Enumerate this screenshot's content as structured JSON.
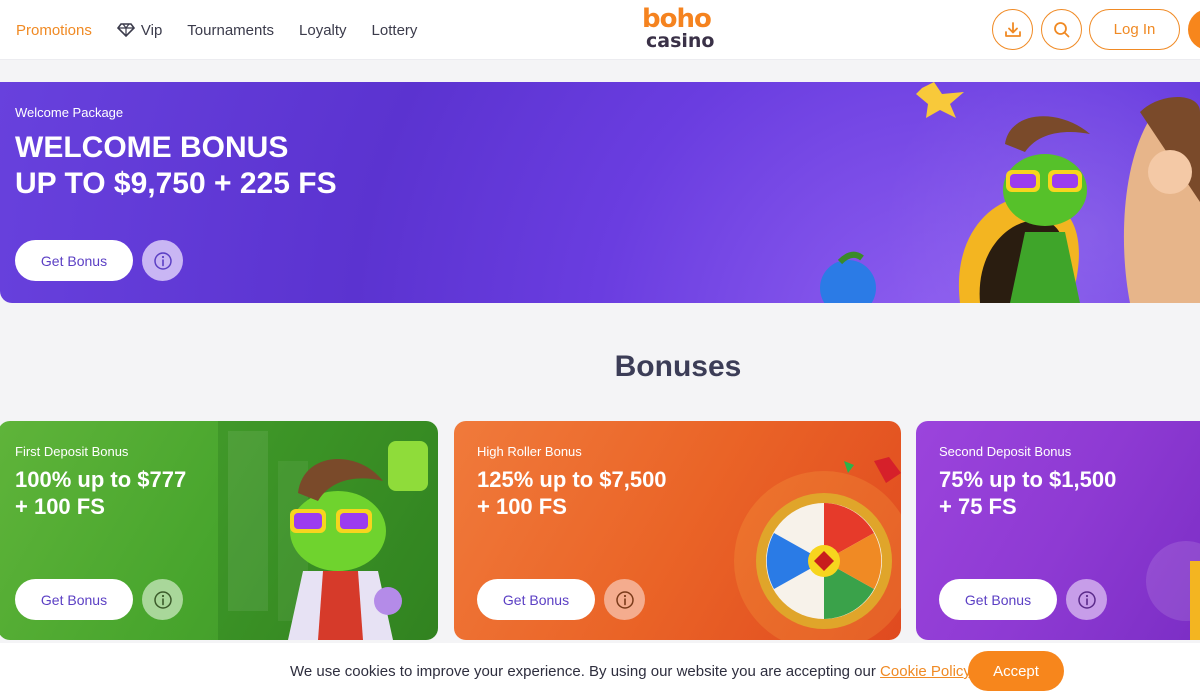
{
  "nav": {
    "items": [
      {
        "label": "Promotions"
      },
      {
        "label": "Vip"
      },
      {
        "label": "Tournaments"
      },
      {
        "label": "Loyalty"
      },
      {
        "label": "Lottery"
      }
    ]
  },
  "logo": {
    "top": "boho",
    "bottom": "casino"
  },
  "header": {
    "login_label": "Log In"
  },
  "hero": {
    "eyebrow": "Welcome Package",
    "title_line1": "WELCOME BONUS",
    "title_line2": "UP TO $9,750 + 225 FS",
    "cta": "Get Bonus"
  },
  "section": {
    "title": "Bonuses"
  },
  "cards": [
    {
      "eyebrow": "First Deposit Bonus",
      "line1": "100% up to $777",
      "line2": "+ 100 FS",
      "cta": "Get Bonus"
    },
    {
      "eyebrow": "High Roller Bonus",
      "line1": "125% up to $7,500",
      "line2": "+ 100 FS",
      "cta": "Get Bonus"
    },
    {
      "eyebrow": "Second Deposit Bonus",
      "line1": "75% up to $1,500",
      "line2": "+ 75 FS",
      "cta": "Get Bonus"
    }
  ],
  "cookie": {
    "text": "We use cookies to improve your experience. By using our website you are accepting our ",
    "link": "Cookie Policy.",
    "accept": "Accept"
  },
  "colors": {
    "accent": "#f08a24",
    "hero": "#6a3de0",
    "card_green": "#48a52d",
    "card_orange": "#ea6427",
    "card_purple": "#8e3ad3"
  }
}
